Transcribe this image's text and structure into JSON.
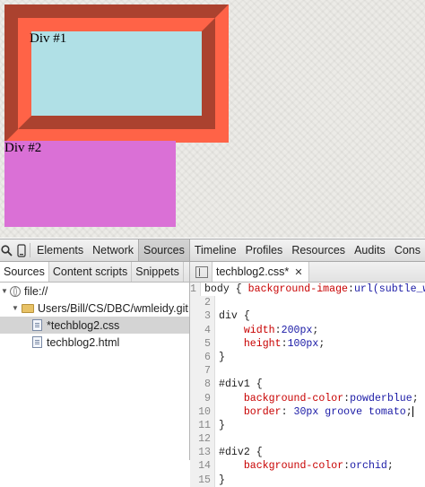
{
  "preview": {
    "div1_label": "Div #1",
    "div2_label": "Div #2"
  },
  "toolbar": {
    "tabs": [
      "Elements",
      "Network",
      "Sources",
      "Timeline",
      "Profiles",
      "Resources",
      "Audits",
      "Cons"
    ],
    "active": "Sources"
  },
  "navigator": {
    "tabs": [
      "Sources",
      "Content scripts",
      "Snippets"
    ],
    "tree": {
      "root": "file://",
      "folder": "Users/Bill/CS/DBC/wmleidy.git",
      "files": [
        "*techblog2.css",
        "techblog2.html"
      ]
    }
  },
  "editor": {
    "tab_label": "techblog2.css*",
    "lines": [
      {
        "n": "1",
        "segs": [
          [
            "t",
            "body { "
          ],
          [
            "p",
            "background-image"
          ],
          [
            "t",
            ":"
          ],
          [
            "v",
            "url(subtle_w"
          ]
        ]
      },
      {
        "n": "2",
        "segs": [
          [
            "t",
            ""
          ]
        ]
      },
      {
        "n": "3",
        "segs": [
          [
            "t",
            "div {"
          ]
        ]
      },
      {
        "n": "4",
        "segs": [
          [
            "t",
            "    "
          ],
          [
            "p",
            "width"
          ],
          [
            "t",
            ":"
          ],
          [
            "v",
            "200px"
          ],
          [
            "t",
            ";"
          ]
        ]
      },
      {
        "n": "5",
        "segs": [
          [
            "t",
            "    "
          ],
          [
            "p",
            "height"
          ],
          [
            "t",
            ":"
          ],
          [
            "v",
            "100px"
          ],
          [
            "t",
            ";"
          ]
        ]
      },
      {
        "n": "6",
        "segs": [
          [
            "t",
            "}"
          ]
        ]
      },
      {
        "n": "7",
        "segs": [
          [
            "t",
            ""
          ]
        ]
      },
      {
        "n": "8",
        "segs": [
          [
            "t",
            "#div1 {"
          ]
        ]
      },
      {
        "n": "9",
        "segs": [
          [
            "t",
            "    "
          ],
          [
            "p",
            "background-color"
          ],
          [
            "t",
            ":"
          ],
          [
            "v",
            "powderblue"
          ],
          [
            "t",
            ";"
          ]
        ]
      },
      {
        "n": "10",
        "segs": [
          [
            "t",
            "    "
          ],
          [
            "p",
            "border"
          ],
          [
            "t",
            ": "
          ],
          [
            "v",
            "30px groove tomato"
          ],
          [
            "t",
            ";"
          ]
        ]
      },
      {
        "n": "11",
        "segs": [
          [
            "t",
            "}"
          ]
        ]
      },
      {
        "n": "12",
        "segs": [
          [
            "t",
            ""
          ]
        ]
      },
      {
        "n": "13",
        "segs": [
          [
            "t",
            "#div2 {"
          ]
        ]
      },
      {
        "n": "14",
        "segs": [
          [
            "t",
            "    "
          ],
          [
            "p",
            "background-color"
          ],
          [
            "t",
            ":"
          ],
          [
            "v",
            "orchid"
          ],
          [
            "t",
            ";"
          ]
        ]
      },
      {
        "n": "15",
        "segs": [
          [
            "t",
            "}"
          ]
        ]
      }
    ]
  },
  "colors": {
    "div1_bg": "#b0e0e6",
    "div1_border": "#ff6347",
    "div2_bg": "#da70d6"
  }
}
